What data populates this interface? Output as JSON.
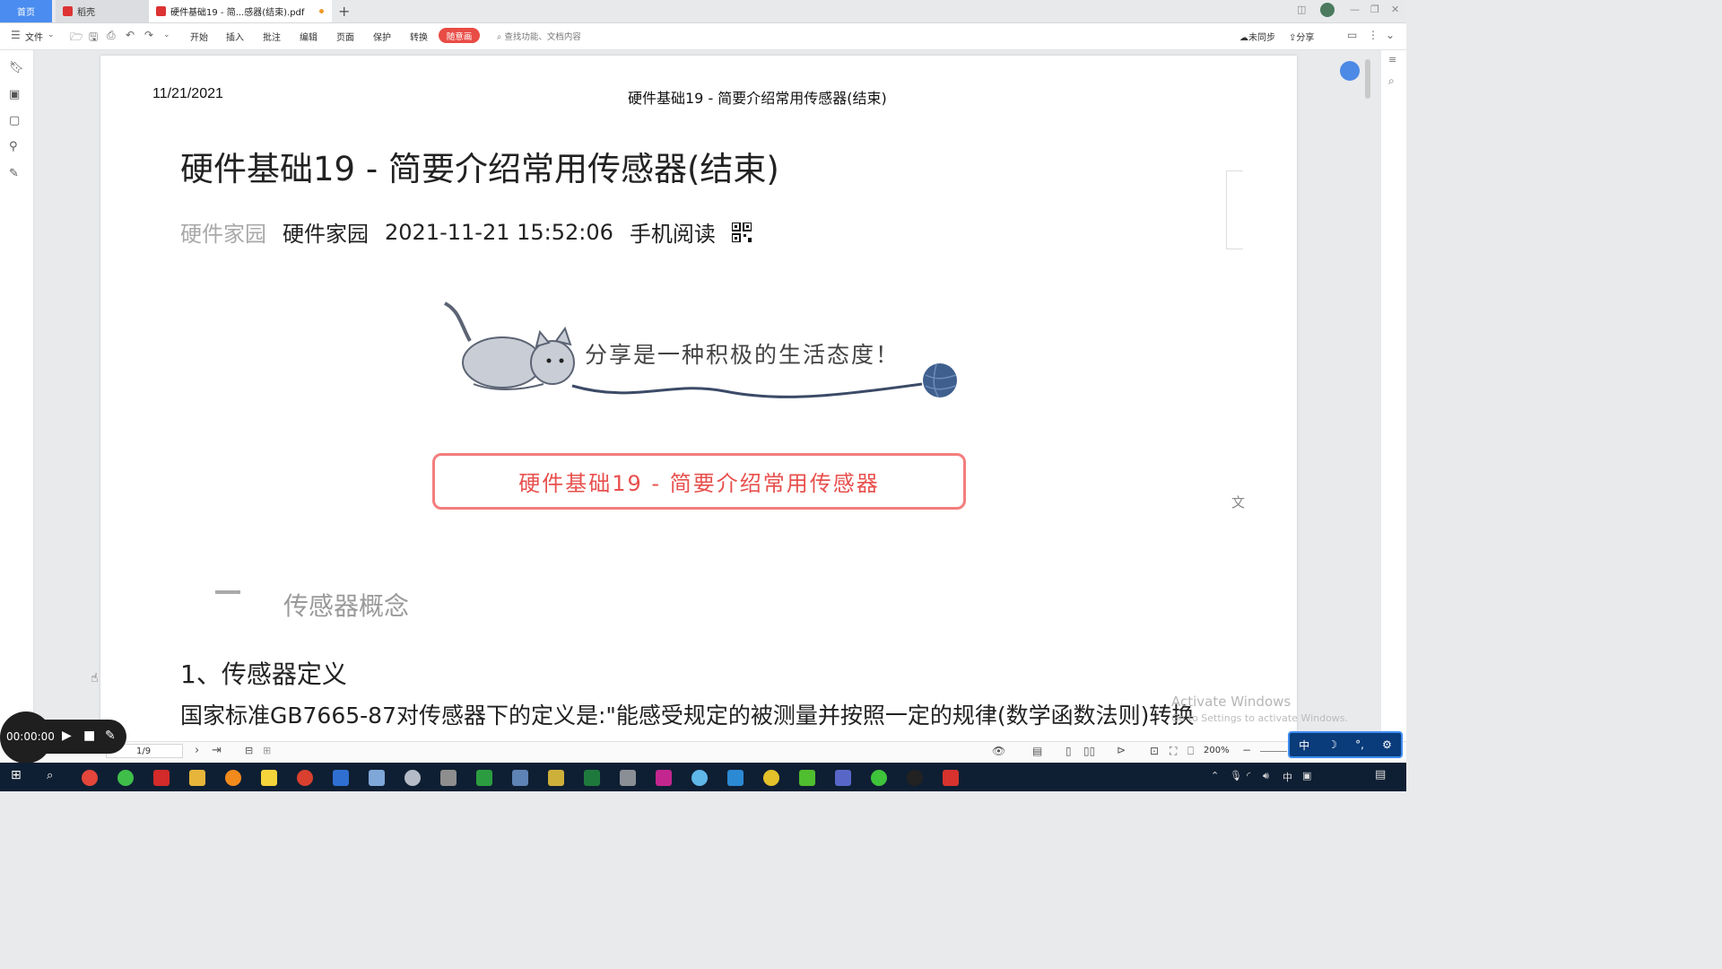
{
  "tabs": {
    "home": "首页",
    "daoke": "稻壳",
    "doc": "硬件基础19 - 简...感器(结束).pdf"
  },
  "toolbar": {
    "file": "文件",
    "menus": [
      "开始",
      "插入",
      "批注",
      "编辑",
      "页面",
      "保护",
      "转换"
    ],
    "highlight": "随意画",
    "search_placeholder": "查找功能、文档内容",
    "sync": "未同步",
    "share": "分享"
  },
  "document": {
    "header_date": "11/21/2021",
    "header_title": "硬件基础19 - 简要介绍常用传感器(结束)",
    "title": "硬件基础19 - 简要介绍常用传感器(结束)",
    "meta_source_gray": "硬件家园",
    "meta_source": "硬件家园",
    "meta_datetime": "2021-11-21 15:52:06",
    "meta_mobile": "手机阅读",
    "slogan": "分享是一种积极的生活态度！",
    "banner": "硬件基础19 - 简要介绍常用传感器",
    "section_title": "传感器概念",
    "heading_1": "1、传感器定义",
    "body_line": "国家标准GB7665-87对传感器下的定义是:\"能感受规定的被测量并按照一定的规律(数学函数法则)转换"
  },
  "watermark": {
    "line1": "Activate Windows",
    "line2": "Go to Settings to activate Windows."
  },
  "statusbar": {
    "page": "1/9",
    "zoom": "200%"
  },
  "recorder": {
    "time": "00:00:00"
  },
  "ime": [
    "中",
    "☽",
    "°,",
    "⚙"
  ],
  "colors": {
    "home_tab": "#4a8cf0",
    "highlight_button": "#e84c45",
    "banner_border": "#f37e7c",
    "banner_text": "#e8504d",
    "taskbar": "#0f1f33"
  }
}
